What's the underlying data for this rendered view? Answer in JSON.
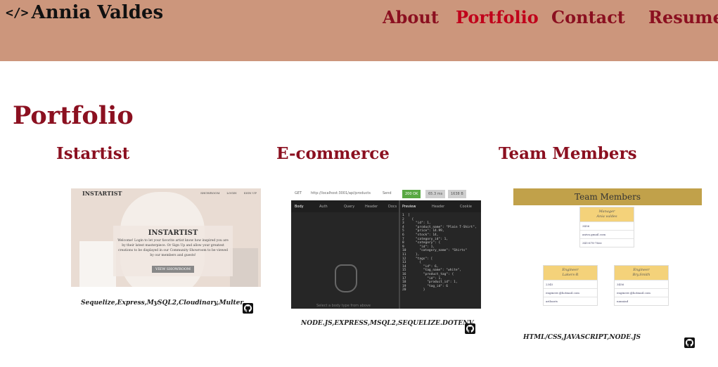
{
  "header": {
    "brand_icon": "</>",
    "brand_name": "Annia Valdes",
    "nav": [
      {
        "label": "About"
      },
      {
        "label": "Portfolio",
        "active": true
      },
      {
        "label": "Contact"
      },
      {
        "label": "Resume"
      }
    ]
  },
  "section": {
    "title": "Portfolio"
  },
  "projects": [
    {
      "title": "Istartist",
      "tech": "Sequelize,Express,MySQL2,Cloudinary,Multer",
      "github_icon": "github-icon",
      "preview": {
        "logo": "INSTARTIST",
        "nav": [
          "SHOWROOM",
          "LOGIN",
          "SIGN UP"
        ],
        "card_title": "INSTARTIST",
        "card_text": "Welcome! Login to let your favorite artist know how inspired you are by their latest masterpiece. Or Sign Up and allow your greatest creations to be displayed in our Community Showroom to be viewed by our members and guests!",
        "card_button": "VIEW SHOWROOM"
      }
    },
    {
      "title": "E-commerce",
      "tech": "NODE.JS,EXPRESS,MSQL2,SEQUELIZE.DOTENV",
      "github_icon": "github-icon",
      "preview": {
        "method": "GET",
        "url": "http://localhost:3001/api/products",
        "send": "Send",
        "status": "200 OK",
        "time": "65.3 ms",
        "size": "1638 B",
        "left_tabs": [
          "Body",
          "Auth",
          "Query",
          "Header",
          "Docs"
        ],
        "right_tabs": [
          "Preview",
          "Header",
          "Cookie"
        ],
        "hint": "Select a body type from above",
        "code_lines": [
          "1  [",
          "2    {",
          "3      \"id\": 1,",
          "4      \"product_name\": \"Plain T-Shirt\",",
          "5      \"price\": 14.99,",
          "6      \"stock\": 14,",
          "7      \"category_id\": 1,",
          "8      \"category\": {",
          "9        \"id\": 1,",
          "10       \"category_name\": \"Shirts\"",
          "11     },",
          "12     \"tags\": [",
          "13       {",
          "14         \"id\": 6,",
          "15         \"tag_name\": \"white\",",
          "16         \"product_tag\": {",
          "17           \"id\": 1,",
          "18           \"product_id\": 1,",
          "19           \"tag_id\": 6",
          "20         }"
        ]
      }
    },
    {
      "title": "Team Members",
      "tech": "HTML/CSS,JAVASCRIPT,NODE.JS",
      "github_icon": "github-icon",
      "preview": {
        "banner": "Team Members",
        "cards": [
          {
            "role": "Manager",
            "name": "Ania valdes",
            "rows": [
              "3456",
              "aniva.gmail.com",
              "345-678-76ee"
            ]
          },
          {
            "role": "Engineer",
            "name": "Lakers-R",
            "rows": [
              "2345",
              "engineer.@hotmail.com",
              "ariloaris"
            ]
          },
          {
            "role": "Engineer",
            "name": "Bry.Smith",
            "rows": [
              "3456",
              "engineer.@hotmail.com",
              "nanaiad"
            ]
          }
        ]
      }
    }
  ],
  "colors": {
    "header_bg": "#cc967c",
    "title": "#8b1020",
    "active_nav": "#c0001a"
  }
}
